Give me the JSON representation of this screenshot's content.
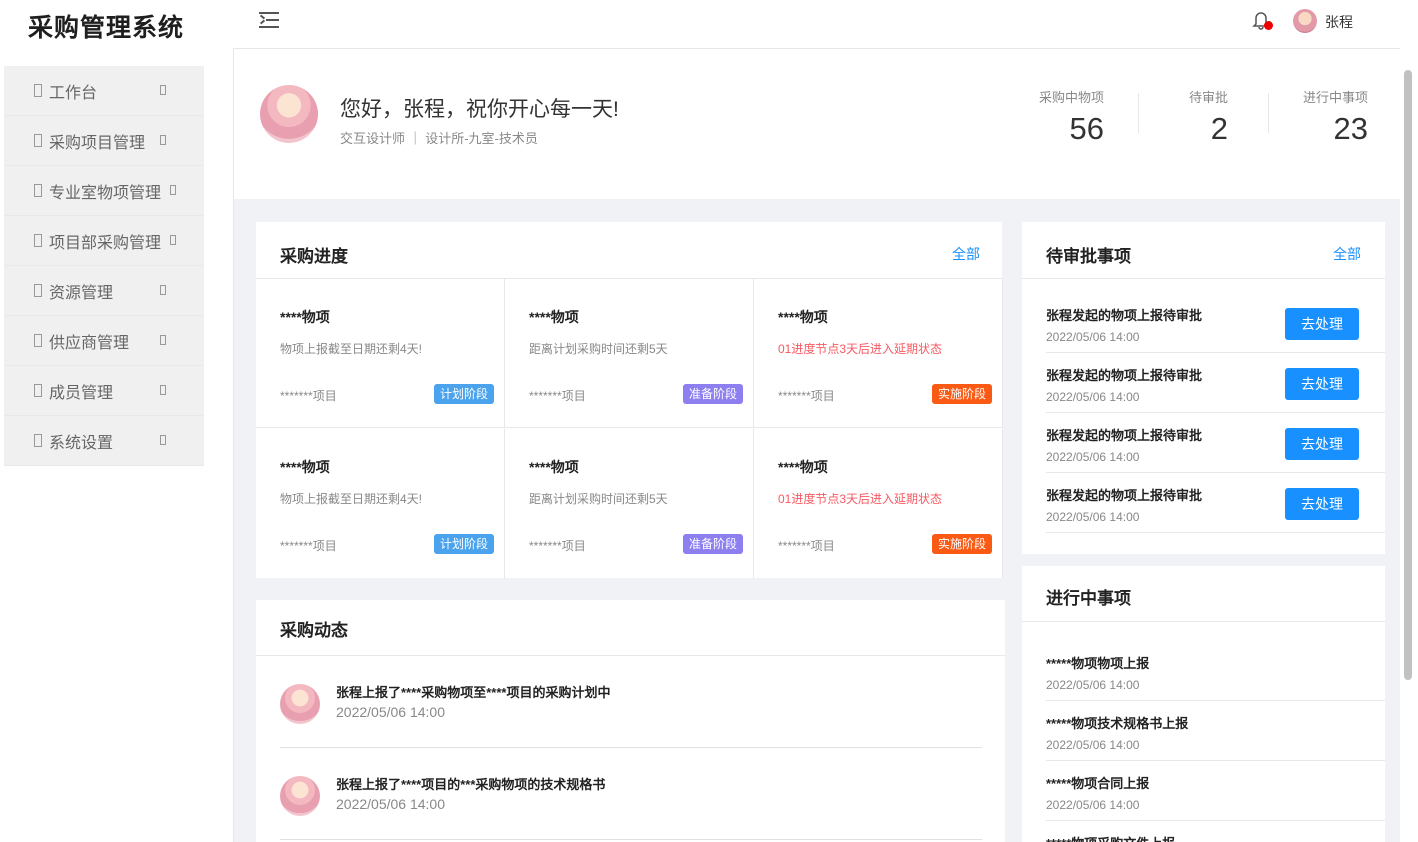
{
  "app": {
    "title": "采购管理系统"
  },
  "sidebar": {
    "items": [
      {
        "label": "工作台"
      },
      {
        "label": "采购项目管理"
      },
      {
        "label": "专业室物项管理"
      },
      {
        "label": "项目部采购管理"
      },
      {
        "label": "资源管理"
      },
      {
        "label": "供应商管理"
      },
      {
        "label": "成员管理"
      },
      {
        "label": "系统设置"
      }
    ]
  },
  "header": {
    "user": "张程"
  },
  "welcome": {
    "greeting": "您好，张程，祝你开心每一天!",
    "profile": "交互设计师 ｜ 设计所-九室-技术员",
    "stats": [
      {
        "label": "采购中物项",
        "value": "56"
      },
      {
        "label": "待审批",
        "value": "2"
      },
      {
        "label": "进行中事项",
        "value": "23"
      }
    ]
  },
  "progress": {
    "title": "采购进度",
    "all": "全部",
    "items": [
      {
        "title": "****物项",
        "desc": "物项上报截至日期还剩4天!",
        "project": "*******项目",
        "stage": "计划阶段",
        "stage_color": "#4aa3ec",
        "warn": false
      },
      {
        "title": "****物项",
        "desc": "距离计划采购时间还剩5天",
        "project": "*******项目",
        "stage": "准备阶段",
        "stage_color": "#8d7ff0",
        "warn": false
      },
      {
        "title": "****物项",
        "desc": "01进度节点3天后进入延期状态",
        "project": "*******项目",
        "stage": "实施阶段",
        "stage_color": "#fa5a14",
        "warn": true
      },
      {
        "title": "****物项",
        "desc": "物项上报截至日期还剩4天!",
        "project": "*******项目",
        "stage": "计划阶段",
        "stage_color": "#4aa3ec",
        "warn": false
      },
      {
        "title": "****物项",
        "desc": "距离计划采购时间还剩5天",
        "project": "*******项目",
        "stage": "准备阶段",
        "stage_color": "#8d7ff0",
        "warn": false
      },
      {
        "title": "****物项",
        "desc": "01进度节点3天后进入延期状态",
        "project": "*******项目",
        "stage": "实施阶段",
        "stage_color": "#fa5a14",
        "warn": true
      }
    ]
  },
  "activity": {
    "title": "采购动态",
    "items": [
      {
        "text": "张程上报了****采购物项至****项目的采购计划中",
        "time": "2022/05/06 14:00"
      },
      {
        "text": "张程上报了****项目的***采购物项的技术规格书",
        "time": "2022/05/06 14:00"
      }
    ]
  },
  "pending": {
    "title": "待审批事项",
    "all": "全部",
    "button": "去处理",
    "items": [
      {
        "title": "张程发起的物项上报待审批",
        "time": "2022/05/06 14:00"
      },
      {
        "title": "张程发起的物项上报待审批",
        "time": "2022/05/06 14:00"
      },
      {
        "title": "张程发起的物项上报待审批",
        "time": "2022/05/06 14:00"
      },
      {
        "title": "张程发起的物项上报待审批",
        "time": "2022/05/06 14:00"
      }
    ]
  },
  "ongoing": {
    "title": "进行中事项",
    "items": [
      {
        "title": "*****物项物项上报",
        "time": "2022/05/06 14:00"
      },
      {
        "title": "*****物项技术规格书上报",
        "time": "2022/05/06 14:00"
      },
      {
        "title": "*****物项合同上报",
        "time": "2022/05/06 14:00"
      },
      {
        "title": "*****物项采购文件上报",
        "time": ""
      }
    ]
  }
}
